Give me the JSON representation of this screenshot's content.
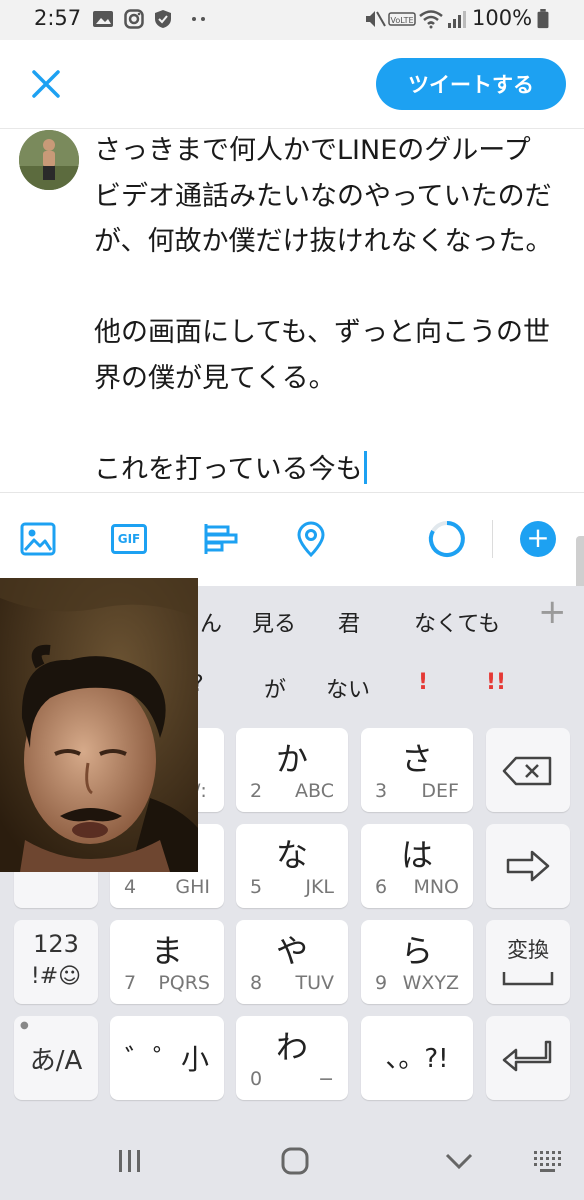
{
  "status_bar": {
    "time": "2:57",
    "battery": "100%"
  },
  "compose": {
    "tweet_button": "ツイートする",
    "text": "さっきまで何人かでLINEのグループ\nビデオ通話みたいなのやっていたのだ\nが、何故か僕だけ抜けれなくなった。\n\n他の画面にしても、ずっと向こうの世\n界の僕が見てくる。\n\nこれを打っている今も"
  },
  "toolbar": {
    "gif_label": "GIF"
  },
  "keyboard": {
    "suggestions_row1": [
      "ん",
      "見る",
      "君",
      "なくても"
    ],
    "suggestions_row2": [
      "?",
      "が",
      "ない",
      "!",
      "!!"
    ],
    "keys": {
      "ka": "か",
      "ka_num": "2",
      "ka_sub": "ABC",
      "sa": "さ",
      "sa_num": "3",
      "sa_sub": "DEF",
      "a_sub": "/:",
      "na": "な",
      "na_num": "5",
      "na_sub": "JKL",
      "ha": "は",
      "ha_num": "6",
      "ha_sub": "MNO",
      "ta_num": "4",
      "ta_sub": "GHI",
      "mode": "123",
      "mode_sub": "!#☺",
      "ma": "ま",
      "ma_num": "7",
      "ma_sub": "PQRS",
      "ya": "や",
      "ya_num": "8",
      "ya_sub": "TUV",
      "ra": "ら",
      "ra_num": "9",
      "ra_sub": "WXYZ",
      "convert": "変換",
      "lang": "あ/A",
      "dakuten": "゛゜小",
      "wa": "わ",
      "wa_num": "0",
      "wa_sub": "−",
      "punct": "、。?!"
    }
  },
  "colors": {
    "accent": "#1da1f2",
    "keyboard_bg": "#e4e5ea",
    "red_suggestion": "#e53935"
  }
}
